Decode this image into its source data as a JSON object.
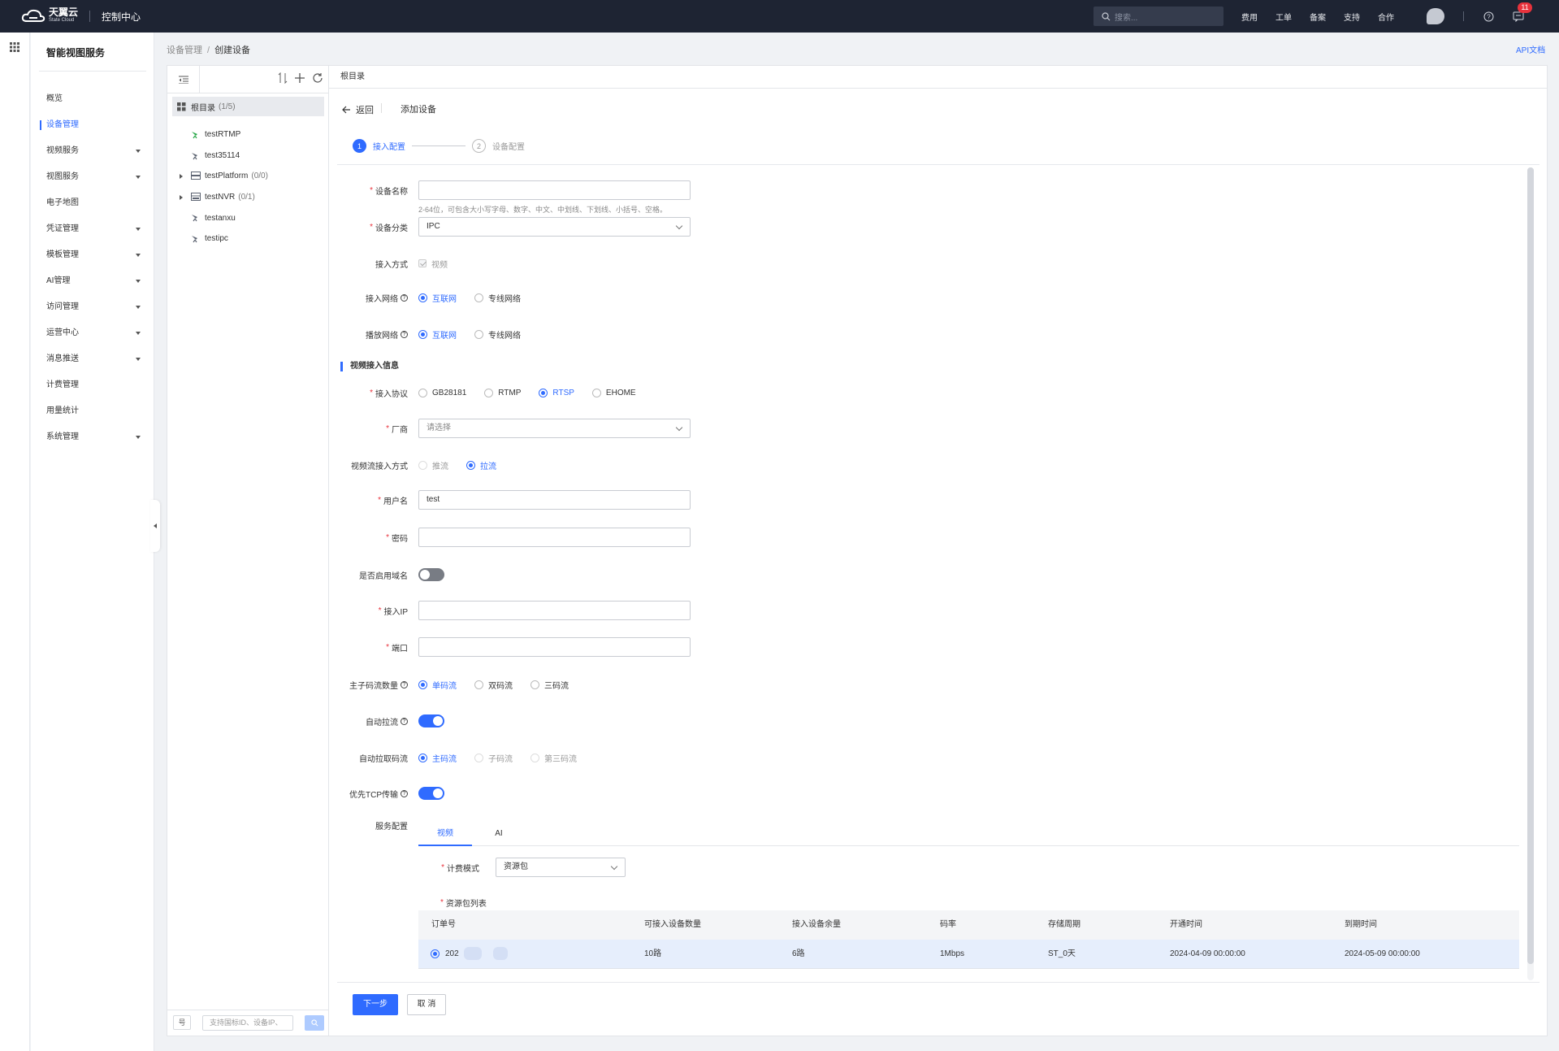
{
  "topbar": {
    "logo_main": "天翼云",
    "logo_sub": "State Cloud",
    "console_label": "控制中心",
    "search_placeholder": "搜索...",
    "links": [
      "费用",
      "工单",
      "备案",
      "支持",
      "合作"
    ],
    "notification_count": "11"
  },
  "sidebar": {
    "title": "智能视图服务",
    "items": [
      {
        "label": "概览",
        "expandable": false,
        "active": false
      },
      {
        "label": "设备管理",
        "expandable": false,
        "active": true
      },
      {
        "label": "视频服务",
        "expandable": true,
        "active": false
      },
      {
        "label": "视图服务",
        "expandable": true,
        "active": false
      },
      {
        "label": "电子地图",
        "expandable": false,
        "active": false
      },
      {
        "label": "凭证管理",
        "expandable": true,
        "active": false
      },
      {
        "label": "模板管理",
        "expandable": true,
        "active": false
      },
      {
        "label": "AI管理",
        "expandable": true,
        "active": false
      },
      {
        "label": "访问管理",
        "expandable": true,
        "active": false
      },
      {
        "label": "运营中心",
        "expandable": true,
        "active": false
      },
      {
        "label": "消息推送",
        "expandable": true,
        "active": false
      },
      {
        "label": "计费管理",
        "expandable": false,
        "active": false
      },
      {
        "label": "用量统计",
        "expandable": false,
        "active": false
      },
      {
        "label": "系统管理",
        "expandable": true,
        "active": false
      }
    ]
  },
  "breadcrumb": {
    "parent": "设备管理",
    "separator": "/",
    "current": "创建设备"
  },
  "api_doc": "API文档",
  "tree": {
    "root_label": "根目录",
    "root_count": "(1/5)",
    "nodes": [
      {
        "label": "testRTMP",
        "count": "",
        "icon": "camera-online-icon",
        "expandable": false
      },
      {
        "label": "test35114",
        "count": "",
        "icon": "camera-icon",
        "expandable": false
      },
      {
        "label": "testPlatform",
        "count": "(0/0)",
        "icon": "platform-icon",
        "expandable": true
      },
      {
        "label": "testNVR",
        "count": "(0/1)",
        "icon": "nvr-icon",
        "expandable": true
      },
      {
        "label": "testanxu",
        "count": "",
        "icon": "camera-icon",
        "expandable": false
      },
      {
        "label": "testipc",
        "count": "",
        "icon": "camera-icon",
        "expandable": false
      }
    ],
    "bottom_button": "号",
    "search_placeholder": "支持国标ID、设备IP、"
  },
  "main": {
    "header": "根目录",
    "back_label": "返回",
    "title": "添加设备",
    "steps": [
      {
        "num": "1",
        "label": "接入配置",
        "active": true
      },
      {
        "num": "2",
        "label": "设备配置",
        "active": false
      }
    ]
  },
  "form": {
    "device_name": {
      "label": "设备名称",
      "value": "",
      "hint": "2-64位，可包含大小写字母、数字、中文、中划线、下划线、小括号、空格。"
    },
    "device_category": {
      "label": "设备分类",
      "value": "IPC"
    },
    "access_mode": {
      "label": "接入方式",
      "option": "视频"
    },
    "access_network": {
      "label": "接入网络",
      "options": [
        "互联网",
        "专线网络"
      ],
      "selected": 0
    },
    "play_network": {
      "label": "播放网络",
      "options": [
        "互联网",
        "专线网络"
      ],
      "selected": 0
    },
    "section_title": "视频接入信息",
    "protocol": {
      "label": "接入协议",
      "options": [
        "GB28181",
        "RTMP",
        "RTSP",
        "EHOME"
      ],
      "selected": 2
    },
    "vendor": {
      "label": "厂商",
      "placeholder": "请选择"
    },
    "stream_mode": {
      "label": "视频流接入方式",
      "options": [
        "推流",
        "拉流"
      ],
      "selected": 1
    },
    "username": {
      "label": "用户名",
      "value": "test"
    },
    "password": {
      "label": "密码",
      "value": ""
    },
    "domain_enabled": {
      "label": "是否启用域名",
      "on": false
    },
    "access_ip": {
      "label": "接入IP",
      "value": ""
    },
    "port": {
      "label": "端口",
      "value": ""
    },
    "stream_count": {
      "label": "主子码流数量",
      "options": [
        "单码流",
        "双码流",
        "三码流"
      ],
      "selected": 0
    },
    "auto_pull": {
      "label": "自动拉流",
      "on": true
    },
    "auto_pull_stream": {
      "label": "自动拉取码流",
      "options": [
        "主码流",
        "子码流",
        "第三码流"
      ],
      "selected": 0
    },
    "prefer_tcp": {
      "label": "优先TCP传输",
      "on": true
    },
    "service_config": {
      "label": "服务配置",
      "tabs": [
        "视频",
        "AI"
      ],
      "active_tab": 0,
      "billing_mode_label": "计费模式",
      "billing_mode_value": "资源包",
      "package_list_label": "资源包列表",
      "table": {
        "columns": [
          "订单号",
          "可接入设备数量",
          "接入设备余量",
          "码率",
          "存储周期",
          "开通时间",
          "到期时间"
        ],
        "rows": [
          [
            "202",
            "10路",
            "6路",
            "1Mbps",
            "ST_0天",
            "2024-04-09 00:00:00",
            "2024-05-09 00:00:00"
          ]
        ]
      }
    }
  },
  "buttons": {
    "next": "下一步",
    "cancel": "取 消"
  },
  "colors": {
    "primary": "#2f6bff",
    "topbar": "#1e2433",
    "required": "#e8323c"
  }
}
